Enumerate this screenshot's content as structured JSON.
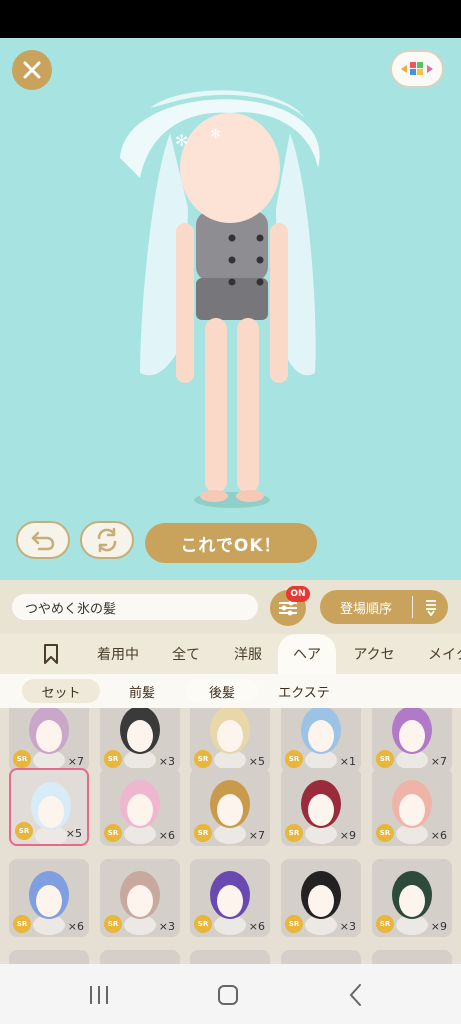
{
  "stage": {
    "ok_label": "これでOK！",
    "close_icon": "close-icon",
    "palette_icon": "palette-toggle-icon",
    "undo_icon": "undo-icon",
    "swap_icon": "swap-icon"
  },
  "toolbar": {
    "item_name": "つやめく氷の髪",
    "filter_badge": "ON",
    "sort_label": "登場順序",
    "sort_icon": "sort-order-icon"
  },
  "tabs": [
    {
      "label": "",
      "icon": "bookmark-icon"
    },
    {
      "label": "着用中"
    },
    {
      "label": "全て"
    },
    {
      "label": "洋服"
    },
    {
      "label": "ヘア",
      "active": true
    },
    {
      "label": "アクセ"
    },
    {
      "label": "メイク"
    }
  ],
  "subtabs": [
    {
      "label": "セット",
      "active": true
    },
    {
      "label": "前髪"
    },
    {
      "label": "後髪"
    },
    {
      "label": "エクステ"
    }
  ],
  "items": [
    {
      "rarity": "SR",
      "count": "×7",
      "color": "#c9a7c9"
    },
    {
      "rarity": "SR",
      "count": "×3",
      "color": "#3a3a3a"
    },
    {
      "rarity": "SR",
      "count": "×5",
      "color": "#e8d7a8"
    },
    {
      "rarity": "SR",
      "count": "×1",
      "color": "#9cc3e6"
    },
    {
      "rarity": "SR",
      "count": "×7",
      "color": "#b07ac9"
    },
    {
      "rarity": "SR",
      "count": "×5",
      "color": "#d8ecf7",
      "selected": true
    },
    {
      "rarity": "SR",
      "count": "×6",
      "color": "#efb6cf"
    },
    {
      "rarity": "SR",
      "count": "×7",
      "color": "#c99a4a"
    },
    {
      "rarity": "SR",
      "count": "×9",
      "color": "#9a2b3a"
    },
    {
      "rarity": "SR",
      "count": "×6",
      "color": "#f0b3a8"
    },
    {
      "rarity": "SR",
      "count": "×6",
      "color": "#7f9fe0"
    },
    {
      "rarity": "SR",
      "count": "×3",
      "color": "#c9a8a0"
    },
    {
      "rarity": "SR",
      "count": "×6",
      "color": "#6a4ab0"
    },
    {
      "rarity": "SR",
      "count": "×3",
      "color": "#222222"
    },
    {
      "rarity": "SR",
      "count": "×9",
      "color": "#2e4a3a"
    }
  ],
  "navbar": {
    "recent_icon": "recent-apps-icon",
    "home_icon": "home-icon",
    "back_icon": "back-icon"
  },
  "colors": {
    "stage_bg": "#a7e4e1",
    "accent_gold": "#c9a35b",
    "badge_red": "#e53935",
    "selected_border": "#e86a8a"
  }
}
